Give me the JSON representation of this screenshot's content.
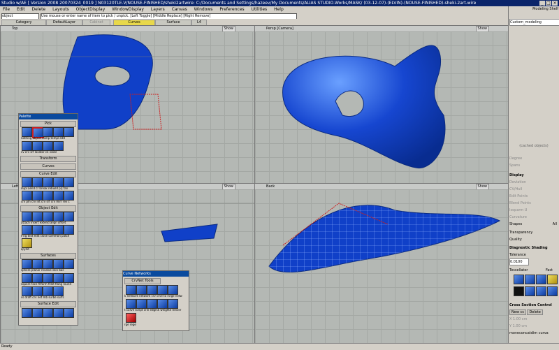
{
  "titlebar": {
    "title": "Studio w/AE  [ Version 2008  20070324_0019 ]  N03120TLE.V/NOUSE-FINISHED/sheki2artwire: C:/Documents and Settings/hazeev/My Documents/ALIAS STUDIO.Works/MASK/ (03-12-07)-(ELVIN)-(NOUSE-FINISHED)-sheki-2art.wire"
  },
  "menu": {
    "items": [
      "File",
      "Edit",
      "Delete",
      "Layouts",
      "ObjectDisplay",
      "WindowDisplay",
      "Layers",
      "Canvas",
      "Windows",
      "Preferences",
      "Utilities",
      "Help"
    ]
  },
  "prompt": {
    "object_field": "object",
    "hint": "Use mouse or enter name of item to pick / unpick. [Left Toggle] [Middle Replace] [Right Remove]"
  },
  "shelf_tabs": {
    "category": "Category",
    "default_layer": "DefaultLayer",
    "cabinet": "Cabinet",
    "curves": "Curves",
    "surface": "Surface",
    "l4": "L4"
  },
  "viewports": {
    "top": {
      "label": "Top",
      "show": "Show"
    },
    "persp": {
      "label": "Persp [Camera]",
      "show": "Show"
    },
    "left": {
      "label": "Left",
      "show": "Show"
    },
    "back": {
      "label": "Back",
      "show": "Show"
    }
  },
  "palette": {
    "title": "Palette",
    "pick": "Pick",
    "pick_labels": [
      "nothing",
      "object",
      "comp",
      "templ",
      "edit"
    ],
    "pick_labels2": [
      "cv",
      "crv srf",
      "locator",
      "ck visibl"
    ],
    "transform": "Transform",
    "curves": "Curves",
    "curve_edit": "Curve Edit",
    "curve_edit_labels": [
      "dupl",
      "aend",
      "cr",
      "break",
      "rebuild",
      "prj tan"
    ],
    "curve_edit_labels2": [
      "crv pln",
      "crv",
      "int",
      "crv",
      "srf",
      "crv",
      "mirr",
      "rev c"
    ],
    "object_edit": "Object Edit",
    "object_edit_labels": [
      "attach",
      "insert",
      "extend",
      "align",
      "offset"
    ],
    "object_edit_labels2": [
      "t-rig",
      "text edit",
      "close",
      "common",
      "patch"
    ],
    "object_edit_labels3": [
      "qrydit"
    ],
    "surfaces": "Surfaces",
    "surface_labels": [
      "sphere",
      "planar",
      "revolve",
      "skin",
      "bail"
    ],
    "surface_labels2": [
      "square",
      "face",
      "filform",
      "fillet",
      "flang",
      "round"
    ],
    "surface_labels3": [
      "ss",
      "draft",
      "crv net",
      "mb",
      "surbe",
      "surfs"
    ],
    "surface_edit": "Surface Edit"
  },
  "curve_networks": {
    "title": "Curve Networks",
    "tools": "CrvNet Tools",
    "labels1": "k network network crv crve to rsrge netw",
    "labels2": "t curve script crin edgrsk weighte tenser",
    "labels3": "rge rege"
  },
  "right_panel": {
    "modeling_shelf": "Modeling Shelf",
    "custom_modeling": "Custom_modeling",
    "control_panel": "(cached objects)",
    "degree": "Degree",
    "spans": "Spans",
    "display": "Display",
    "deviation": "Deviation",
    "cv_hull": "CV/Hull",
    "edit_points": "Edit Points",
    "blend_points": "Blend Points",
    "isoparm_u": "Isoparm U",
    "curvature": "Curvature",
    "shapes": "Shapes",
    "all": "All",
    "transparency": "Transparency",
    "quality": "Quality",
    "diagnostic": "Diagnostic Shading",
    "tolerance": "Tolerance",
    "tolerance_value": "0.0100",
    "tessellator": "Tessellator",
    "fast": "Fast",
    "cross_section": "Cross Section Control",
    "new_cs": "New cs",
    "delete": "Delete",
    "x_value": "X 1.00 cm",
    "y_value": "Y 1.00 cm",
    "footer": "moveconcatdim curva"
  },
  "status": {
    "text": "Ready"
  },
  "colors": {
    "surface_blue": "#1040c8",
    "title_bg": "#0a246a",
    "shelf_active": "#e8d84a",
    "curve_red": "#cc2020"
  }
}
